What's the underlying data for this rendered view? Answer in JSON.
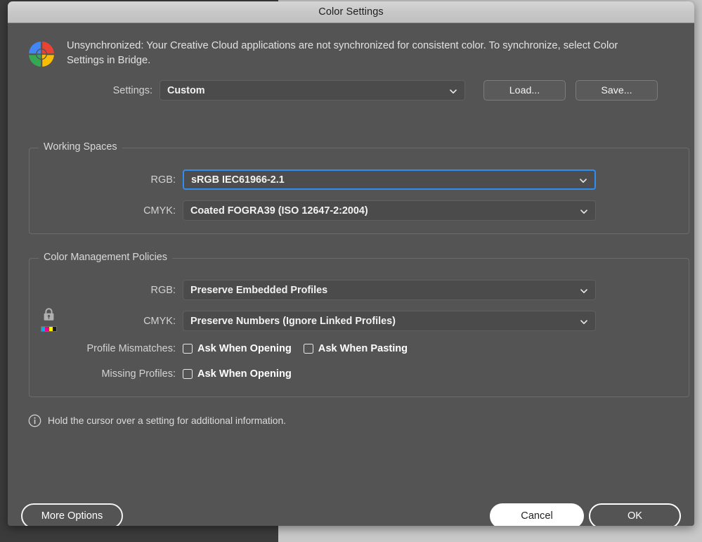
{
  "window": {
    "title": "Color Settings"
  },
  "notice": {
    "icon": "color-sync-icon",
    "text": "Unsynchronized: Your Creative Cloud applications are not synchronized for consistent color. To synchronize, select Color Settings in Bridge."
  },
  "settings_row": {
    "label": "Settings:",
    "value": "Custom",
    "chevron_icon": "chevron-down-icon",
    "load_label": "Load...",
    "save_label": "Save..."
  },
  "working_spaces": {
    "legend": "Working Spaces",
    "rows": [
      {
        "label": "RGB:",
        "value": "sRGB IEC61966-2.1",
        "focused": true
      },
      {
        "label": "CMYK:",
        "value": "Coated FOGRA39 (ISO 12647-2:2004)",
        "focused": false
      }
    ]
  },
  "policies": {
    "legend": "Color Management Policies",
    "lock_icon": "lock-icon",
    "cmyk_swatch_icon": "cmyk-swatch-icon",
    "rows": [
      {
        "label": "RGB:",
        "value": "Preserve Embedded Profiles"
      },
      {
        "label": "CMYK:",
        "value": "Preserve Numbers (Ignore Linked Profiles)"
      }
    ],
    "checkbox_rows": [
      {
        "label": "Profile Mismatches:",
        "items": [
          {
            "text": "Ask When Opening",
            "checked": false
          },
          {
            "text": "Ask When Pasting",
            "checked": false
          }
        ]
      },
      {
        "label": "Missing Profiles:",
        "items": [
          {
            "text": "Ask When Opening",
            "checked": false
          }
        ]
      }
    ]
  },
  "info": {
    "icon": "info-circle-icon",
    "text": "Hold the cursor over a setting for additional information."
  },
  "footer": {
    "more_options_label": "More Options",
    "cancel_label": "Cancel",
    "ok_label": "OK"
  },
  "colors": {
    "dialog_background": "#545454",
    "titlebar": "#c8c8c8",
    "focus_blue": "#2f8ef0",
    "text_primary": "#f2f2f2",
    "text_label": "#d2d2d2",
    "cyan": "#00aeef",
    "magenta": "#ec008c",
    "yellow": "#fff200",
    "black": "#1a1a1a"
  }
}
